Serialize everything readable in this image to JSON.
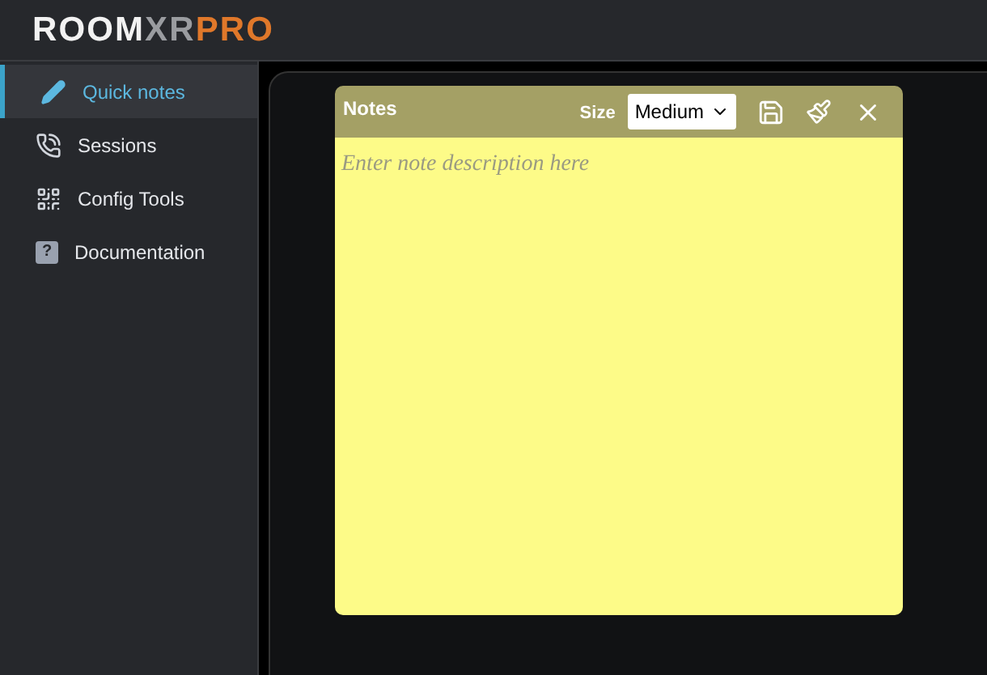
{
  "logo": {
    "parts": [
      {
        "text": "ROOM",
        "color": "#f2f2f2"
      },
      {
        "text": "XR",
        "color": "#9a9ca0"
      },
      {
        "text": "PRO",
        "color": "#e0782a"
      }
    ]
  },
  "sidebar": {
    "items": [
      {
        "label": "Quick notes",
        "kind": "pencil",
        "selected": true
      },
      {
        "label": "Sessions",
        "kind": "phone",
        "selected": false
      },
      {
        "label": "Config Tools",
        "kind": "qr",
        "selected": false
      },
      {
        "label": "Documentation",
        "kind": "help",
        "icon_glyph": "?",
        "selected": false
      }
    ]
  },
  "notes": {
    "title": "Notes",
    "size_label": "Size",
    "size": "Medium",
    "placeholder": "Enter note description here"
  }
}
